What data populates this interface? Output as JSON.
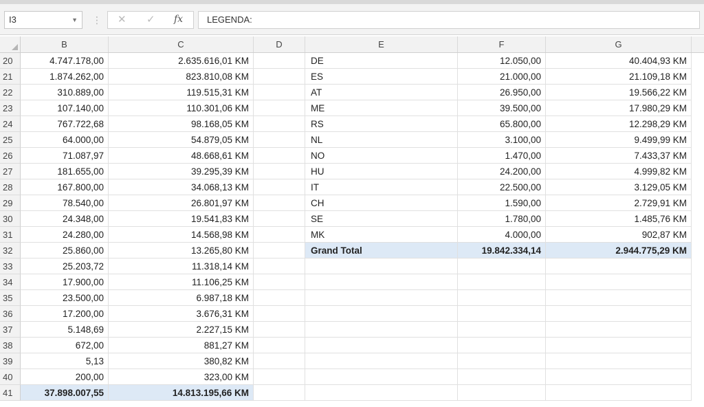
{
  "formula_bar": {
    "name_box": "I3",
    "formula": "LEGENDA:"
  },
  "columns": [
    "B",
    "C",
    "D",
    "E",
    "F",
    "G"
  ],
  "rows": [
    {
      "n": "20",
      "b": "4.747.178,00",
      "c": "2.635.616,01 KM",
      "e": "DE",
      "f": "12.050,00",
      "g": "40.404,93 KM"
    },
    {
      "n": "21",
      "b": "1.874.262,00",
      "c": "823.810,08 KM",
      "e": "ES",
      "f": "21.000,00",
      "g": "21.109,18 KM"
    },
    {
      "n": "22",
      "b": "310.889,00",
      "c": "119.515,31 KM",
      "e": "AT",
      "f": "26.950,00",
      "g": "19.566,22 KM"
    },
    {
      "n": "23",
      "b": "107.140,00",
      "c": "110.301,06 KM",
      "e": "ME",
      "f": "39.500,00",
      "g": "17.980,29 KM"
    },
    {
      "n": "24",
      "b": "767.722,68",
      "c": "98.168,05 KM",
      "e": "RS",
      "f": "65.800,00",
      "g": "12.298,29 KM"
    },
    {
      "n": "25",
      "b": "64.000,00",
      "c": "54.879,05 KM",
      "e": "NL",
      "f": "3.100,00",
      "g": "9.499,99 KM"
    },
    {
      "n": "26",
      "b": "71.087,97",
      "c": "48.668,61 KM",
      "e": "NO",
      "f": "1.470,00",
      "g": "7.433,37 KM"
    },
    {
      "n": "27",
      "b": "181.655,00",
      "c": "39.295,39 KM",
      "e": "HU",
      "f": "24.200,00",
      "g": "4.999,82 KM"
    },
    {
      "n": "28",
      "b": "167.800,00",
      "c": "34.068,13 KM",
      "e": "IT",
      "f": "22.500,00",
      "g": "3.129,05 KM"
    },
    {
      "n": "29",
      "b": "78.540,00",
      "c": "26.801,97 KM",
      "e": "CH",
      "f": "1.590,00",
      "g": "2.729,91 KM"
    },
    {
      "n": "30",
      "b": "24.348,00",
      "c": "19.541,83 KM",
      "e": "SE",
      "f": "1.780,00",
      "g": "1.485,76 KM"
    },
    {
      "n": "31",
      "b": "24.280,00",
      "c": "14.568,98 KM",
      "e": "MK",
      "f": "4.000,00",
      "g": "902,87 KM"
    },
    {
      "n": "32",
      "b": "25.860,00",
      "c": "13.265,80 KM",
      "e": "Grand Total",
      "f": "19.842.334,14",
      "g": "2.944.775,29 KM",
      "efg_total": true
    },
    {
      "n": "33",
      "b": "25.203,72",
      "c": "11.318,14 KM",
      "e": "",
      "f": "",
      "g": ""
    },
    {
      "n": "34",
      "b": "17.900,00",
      "c": "11.106,25 KM",
      "e": "",
      "f": "",
      "g": ""
    },
    {
      "n": "35",
      "b": "23.500,00",
      "c": "6.987,18 KM",
      "e": "",
      "f": "",
      "g": ""
    },
    {
      "n": "36",
      "b": "17.200,00",
      "c": "3.676,31 KM",
      "e": "",
      "f": "",
      "g": ""
    },
    {
      "n": "37",
      "b": "5.148,69",
      "c": "2.227,15 KM",
      "e": "",
      "f": "",
      "g": ""
    },
    {
      "n": "38",
      "b": "672,00",
      "c": "881,27 KM",
      "e": "",
      "f": "",
      "g": ""
    },
    {
      "n": "39",
      "b": "5,13",
      "c": "380,82 KM",
      "e": "",
      "f": "",
      "g": ""
    },
    {
      "n": "40",
      "b": "200,00",
      "c": "323,00 KM",
      "e": "",
      "f": "",
      "g": ""
    },
    {
      "n": "41",
      "b": "37.898.007,55",
      "c": "14.813.195,66 KM",
      "e": "",
      "f": "",
      "g": "",
      "bc_total": true
    }
  ],
  "colors": {
    "total_highlight": "#dde9f6",
    "header_bg": "#f2f2f2",
    "gridline": "#e0e0e0"
  }
}
